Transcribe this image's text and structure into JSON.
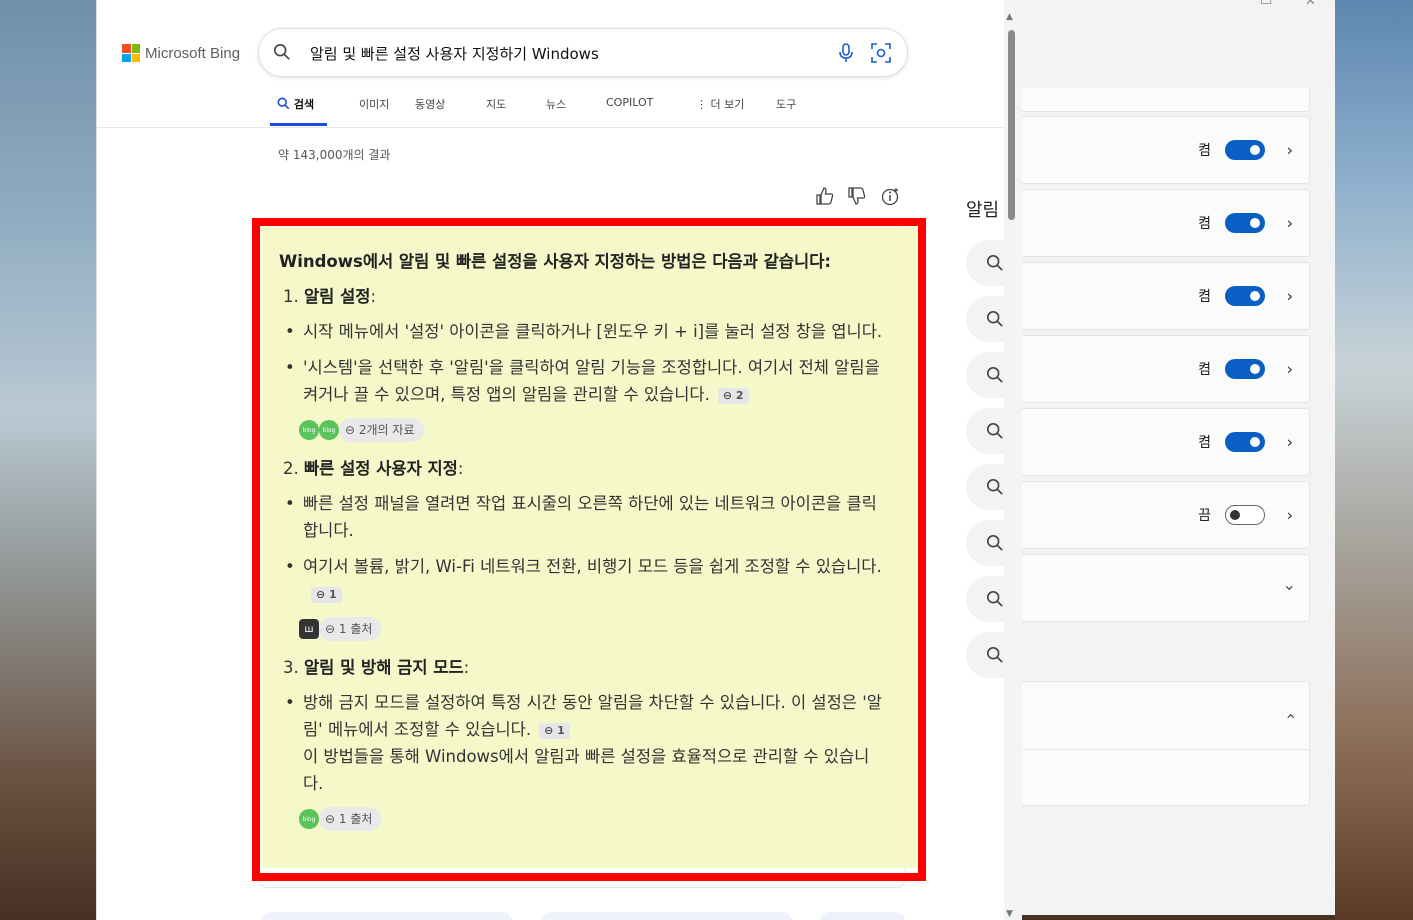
{
  "search": {
    "brand": "Microsoft Bing",
    "query": "알림 및 빠른 설정 사용자 지정하기 Windows"
  },
  "tabs": [
    {
      "label": "검색",
      "active": true
    },
    {
      "label": "이미지"
    },
    {
      "label": "동영상"
    },
    {
      "label": "지도"
    },
    {
      "label": "뉴스"
    },
    {
      "label": "COPILOT"
    },
    {
      "label": "⋮ 더 보기"
    },
    {
      "label": "도구"
    }
  ],
  "results_count": "약 143,000개의 결과",
  "answer": {
    "heading": "Windows에서 알림 및 빠른 설정을 사용자 지정하는 방법은 다음과 같습니다:",
    "sections": [
      {
        "number": "1.",
        "title": "알림 설정",
        "bullets": [
          "시작 메뉴에서 '설정' 아이콘을 클릭하거나 [윈도우 키 + i]를 눌러 설정 창을 엽니다.",
          "'시스템'을 선택한 후 '알림'을 클릭하여 알림 기능을 조정합니다. 여기서 전체 알림을 켜거나 끌 수 있으며, 특정 앱의 알림을 관리할 수 있습니다."
        ],
        "citation": "2",
        "sources": "2개의 자료"
      },
      {
        "number": "2.",
        "title": "빠른 설정 사용자 지정",
        "bullets": [
          "빠른 설정 패널을 열려면 작업 표시줄의 오른쪽 하단에 있는 네트워크 아이콘을 클릭합니다.",
          "여기서 볼륨, 밝기, Wi-Fi 네트워크 전환, 비행기 모드 등을 쉽게 조정할 수 있습니다."
        ],
        "citation": "1",
        "sources": "1 출처"
      },
      {
        "number": "3.",
        "title": "알림 및 방해 금지 모드",
        "bullets": [
          "방해 금지 모드를 설정하여 특정 시간 동안 알림을 차단할 수 있습니다. 이 설정은 '알림' 메뉴에서 조정할 수 있습니다."
        ],
        "citation": "1",
        "closing": "이 방법들을 통해 Windows에서 알림과 빠른 설정을 효율적으로 관리할 수 있습니다.",
        "sources": "1 출처"
      }
    ]
  },
  "sidebar": {
    "title": "알림"
  },
  "settings_rows": [
    {
      "state": "켬",
      "on": true
    },
    {
      "state": "켬",
      "on": true
    },
    {
      "state": "켬",
      "on": true
    },
    {
      "state": "켬",
      "on": true
    },
    {
      "state": "켬",
      "on": true
    },
    {
      "state": "끔",
      "on": false
    }
  ],
  "colors": {
    "accent": "#174ae4",
    "toggle_on": "#0a5fc4",
    "highlight": "#f5f8c8",
    "annotation_box": "#ff0000"
  }
}
